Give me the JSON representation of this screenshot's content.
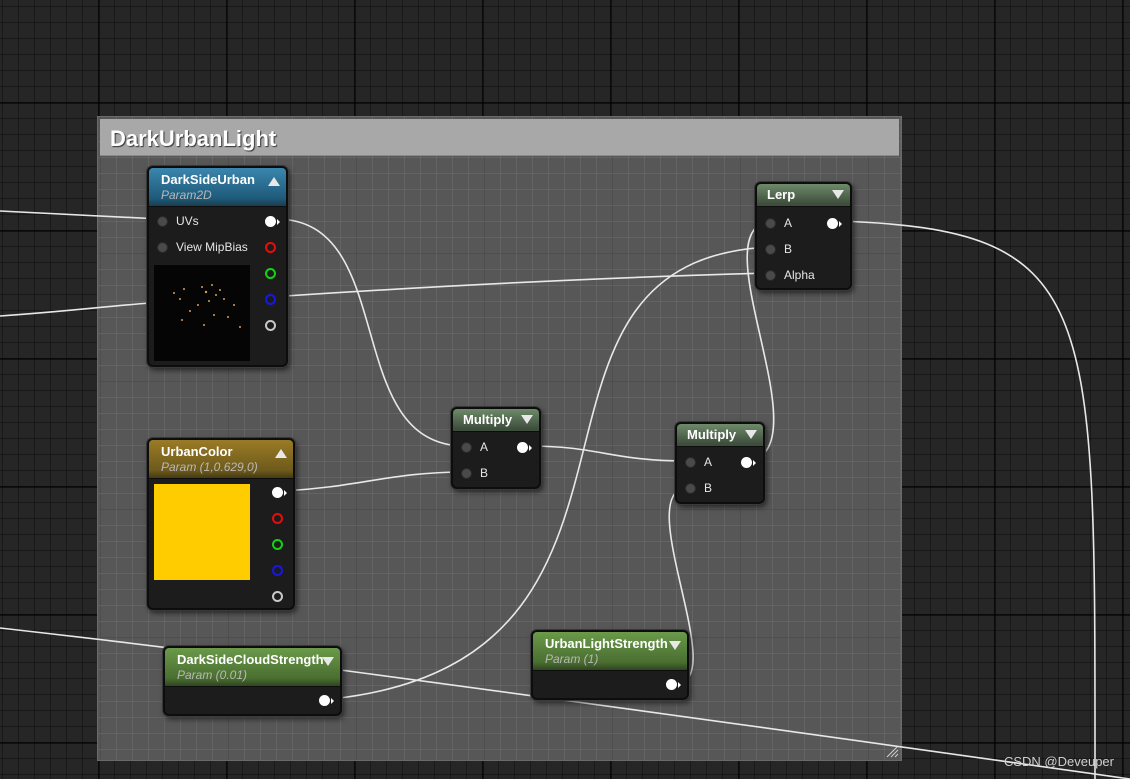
{
  "comment": {
    "title": "DarkUrbanLight",
    "color": "#a8a8a8"
  },
  "nodes": {
    "texture": {
      "title": "DarkSideUrban",
      "subtitle": "Param2D",
      "inputs": [
        "UVs",
        "View MipBias"
      ]
    },
    "urban_color": {
      "title": "UrbanColor",
      "subtitle": "Param (1,0.629,0)",
      "swatch_color": "#ffcc00"
    },
    "cloud_strength": {
      "title": "DarkSideCloudStrength",
      "subtitle": "Param (0.01)"
    },
    "multiply1": {
      "title": "Multiply",
      "inputs": [
        "A",
        "B"
      ]
    },
    "multiply2": {
      "title": "Multiply",
      "inputs": [
        "A",
        "B"
      ]
    },
    "light_strength": {
      "title": "UrbanLightStrength",
      "subtitle": "Param (1)"
    },
    "lerp": {
      "title": "Lerp",
      "inputs": [
        "A",
        "B",
        "Alpha"
      ]
    }
  },
  "icons": [
    "collapse-arrow-icon",
    "resize-grip-icon"
  ],
  "colors": {
    "wire": "#e8e8e8",
    "pin_red": "#e01010",
    "pin_green": "#18d018",
    "pin_blue": "#1818e0"
  },
  "watermark": "CSDN @Deveuper"
}
